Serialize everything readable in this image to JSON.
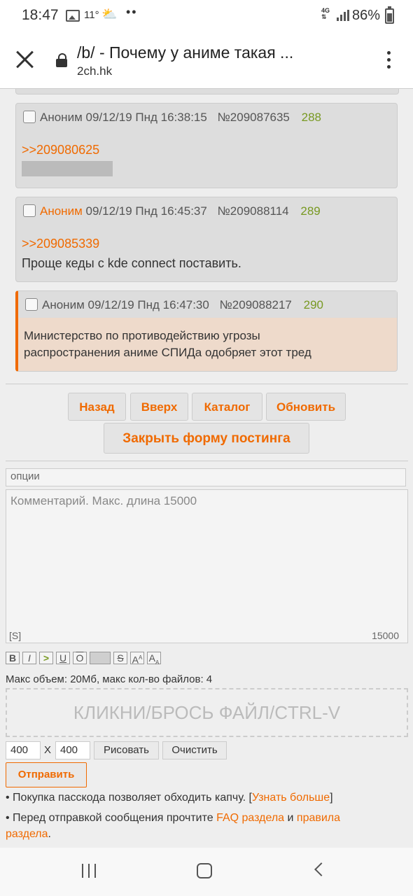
{
  "status_bar": {
    "time": "18:47",
    "temperature": "11°",
    "more": "••",
    "network": "4G",
    "battery": "86%"
  },
  "browser": {
    "title": "/b/ - Почему у аниме такая ...",
    "host": "2ch.hk"
  },
  "posts": [
    {
      "author": "Аноним",
      "datetime": "09/12/19 Пнд 16:38:15",
      "number": "№209087635",
      "index": "288",
      "reply_to": ">>209080625",
      "text": ""
    },
    {
      "author": "Аноним",
      "datetime": "09/12/19 Пнд 16:45:37",
      "number": "№209088114",
      "index": "289",
      "reply_to": ">>209085339",
      "text": "Проще кеды с kde connect поставить."
    },
    {
      "author": "Аноним",
      "datetime": "09/12/19 Пнд 16:47:30",
      "number": "№209088217",
      "index": "290",
      "reply_to": "",
      "text_line1": "Министерство по противодействию угрозы",
      "text_line2": "распространения аниме СПИДа одобряет этот тред"
    }
  ],
  "nav": {
    "back": "Назад",
    "up": "Вверх",
    "catalog": "Каталог",
    "refresh": "Обновить",
    "close_form": "Закрыть форму постинга"
  },
  "form": {
    "options_value": "опции",
    "comment_placeholder": "Комментарий. Макс. длина 15000",
    "spoiler_tag": "[S]",
    "char_limit": "15000",
    "toolbar": {
      "bold": "B",
      "italic": "I",
      "quote": ">",
      "underline": "U",
      "overline": "O",
      "strike": "S",
      "superscript": "A",
      "subscript": "A"
    },
    "limits": "Макс объем: 20Мб, макс кол-во файлов: 4",
    "dropzone": "КЛИКНИ/БРОСЬ ФАЙЛ/CTRL-V",
    "width_value": "400",
    "x_label": "X",
    "height_value": "400",
    "draw_button": "Рисовать",
    "clear_button": "Очистить",
    "submit_button": "Отправить"
  },
  "notes": {
    "passcode_text": "• Покупка пасскода позволяет обходить капчу. [",
    "passcode_link": "Узнать больше",
    "passcode_close": "]",
    "faq_text": "• Перед отправкой сообщения прочтите ",
    "faq_link": "FAQ раздела",
    "faq_and": " и ",
    "rules_link_1": "правила",
    "rules_link_2": "раздела",
    "faq_end": "."
  }
}
